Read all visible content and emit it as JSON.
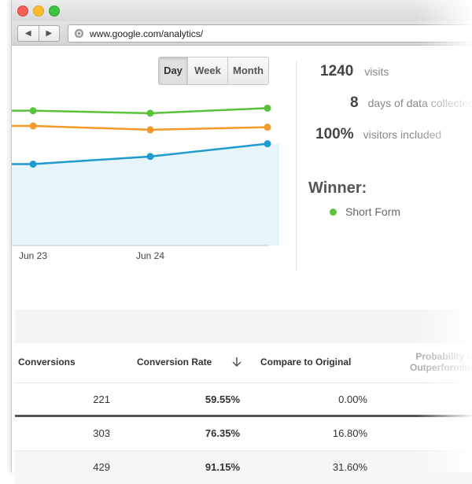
{
  "browser": {
    "url": "www.google.com/analytics/"
  },
  "range_buttons": {
    "day": "Day",
    "week": "Week",
    "month": "Month",
    "selected": "Day"
  },
  "chart_data": {
    "type": "line",
    "x": [
      "Jun 23",
      "Jun 24",
      ""
    ],
    "series": [
      {
        "values": [
          93,
          92,
          94
        ],
        "color": "#5ac339"
      },
      {
        "values": [
          87,
          85.5,
          86.5
        ],
        "color": "#f39a29"
      },
      {
        "values": [
          72,
          75,
          80
        ],
        "color": "#1f9bd0",
        "fill": "#e6f4fb"
      }
    ],
    "ylim": [
      40,
      100
    ],
    "xlabel": "",
    "ylabel": "",
    "grid": false
  },
  "stats": [
    {
      "value": "1240",
      "label": "visits"
    },
    {
      "value": "8",
      "label": "days of data collected"
    },
    {
      "value": "100%",
      "label": "visitors included"
    }
  ],
  "winner": {
    "title": "Winner:",
    "name": "Short Form",
    "color": "#5ac339"
  },
  "table": {
    "headers": {
      "conversions": "Conversions",
      "conversion_rate": "Conversion Rate",
      "compare": "Compare to Original",
      "probability_line1": "Probability of",
      "probability_line2": "Outperforming"
    },
    "rows": [
      {
        "conversions": "221",
        "rate": "59.55%",
        "compare": "0.00%"
      },
      {
        "conversions": "303",
        "rate": "76.35%",
        "compare": "16.80%"
      },
      {
        "conversions": "429",
        "rate": "91.15%",
        "compare": "31.60%"
      }
    ]
  }
}
